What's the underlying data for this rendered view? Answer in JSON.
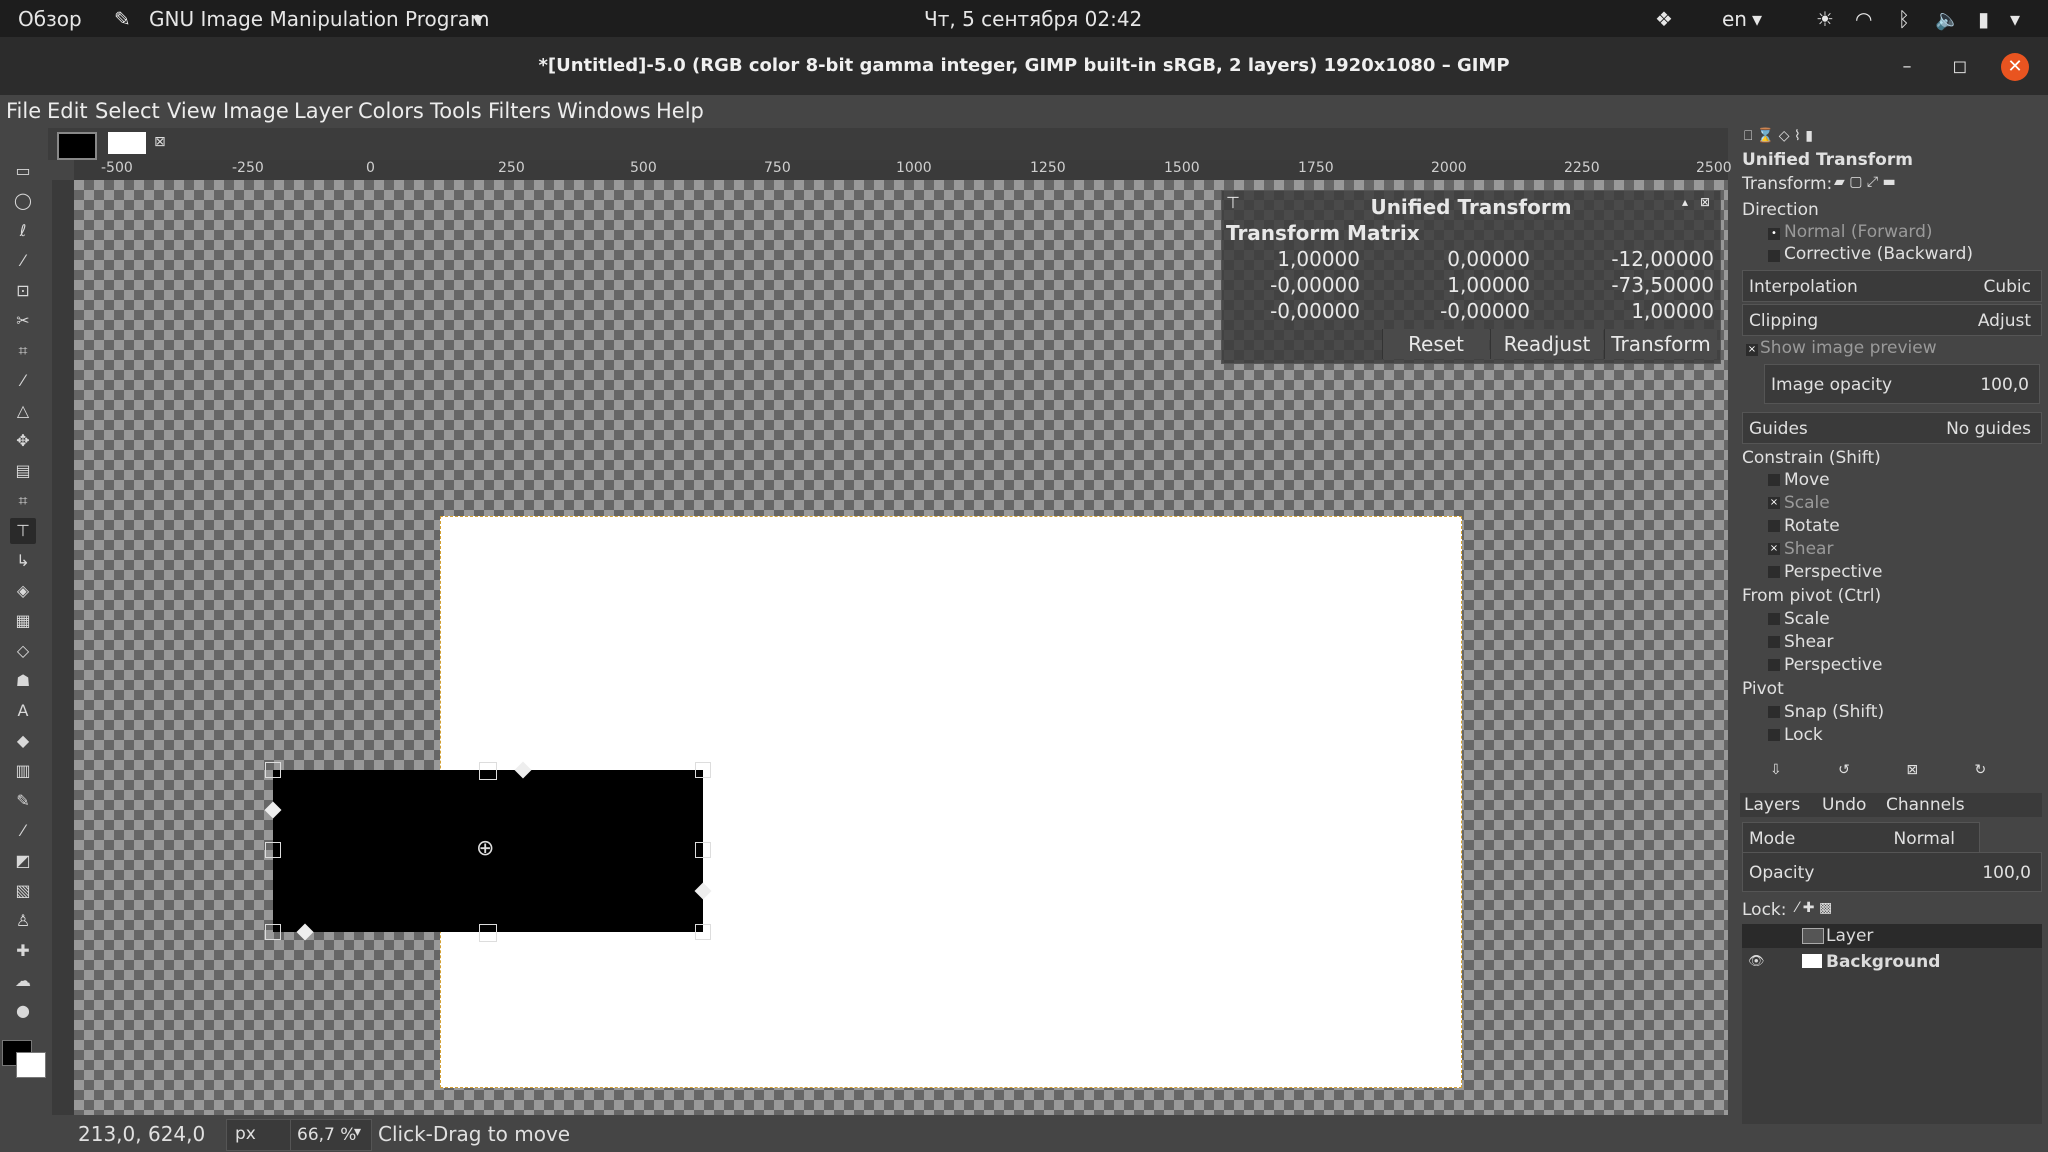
{
  "topbar": {
    "overview": "Обзор",
    "app_name": "GNU Image Manipulation Program",
    "clock": "Чт, 5 сентября  02:42",
    "lang": "en"
  },
  "window": {
    "title": "*[Untitled]-5.0 (RGB color 8-bit gamma integer, GIMP built-in sRGB, 2 layers) 1920x1080 – GIMP"
  },
  "menu": [
    "File",
    "Edit",
    "Select",
    "View",
    "Image",
    "Layer",
    "Colors",
    "Tools",
    "Filters",
    "Windows",
    "Help"
  ],
  "ruler": {
    "h": [
      "-500",
      "-250",
      "0",
      "250",
      "500",
      "750",
      "1000",
      "1250",
      "1500",
      "1750",
      "2000",
      "2250",
      "2500"
    ]
  },
  "dialog": {
    "title": "Unified Transform",
    "matrix_label": "Transform Matrix",
    "matrix": [
      [
        "1,00000",
        "0,00000",
        "-12,00000"
      ],
      [
        "-0,00000",
        "1,00000",
        "-73,50000"
      ],
      [
        "-0,00000",
        "-0,00000",
        "1,00000"
      ]
    ],
    "reset": "Reset",
    "readjust": "Readjust",
    "transform": "Transform"
  },
  "status": {
    "coords": "213,0, 624,0",
    "unit": "px",
    "zoom": "66,7 %",
    "hint": "Click-Drag to move"
  },
  "options": {
    "title": "Unified Transform",
    "transform_label": "Transform:",
    "direction": "Direction",
    "normal": "Normal (Forward)",
    "corrective": "Corrective (Backward)",
    "interpolation": "Interpolation",
    "interpolation_val": "Cubic",
    "clipping": "Clipping",
    "clipping_val": "Adjust",
    "show_preview": "Show image preview",
    "opacity": "Image opacity",
    "opacity_val": "100,0",
    "guides": "Guides",
    "guides_val": "No guides",
    "constrain": "Constrain (Shift)",
    "c_move": "Move",
    "c_scale": "Scale",
    "c_rotate": "Rotate",
    "c_shear": "Shear",
    "c_perspective": "Perspective",
    "frompivot": "From pivot  (Ctrl)",
    "p_scale": "Scale",
    "p_shear": "Shear",
    "p_perspective": "Perspective",
    "pivot": "Pivot",
    "snap": "Snap (Shift)",
    "lock": "Lock"
  },
  "layers": {
    "tab_layers": "Layers",
    "tab_undo": "Undo",
    "tab_channels": "Channels",
    "mode": "Mode",
    "mode_val": "Normal",
    "opacity": "Opacity",
    "opacity_val": "100,0",
    "lock": "Lock:",
    "items": [
      "Layer",
      "Background"
    ]
  }
}
